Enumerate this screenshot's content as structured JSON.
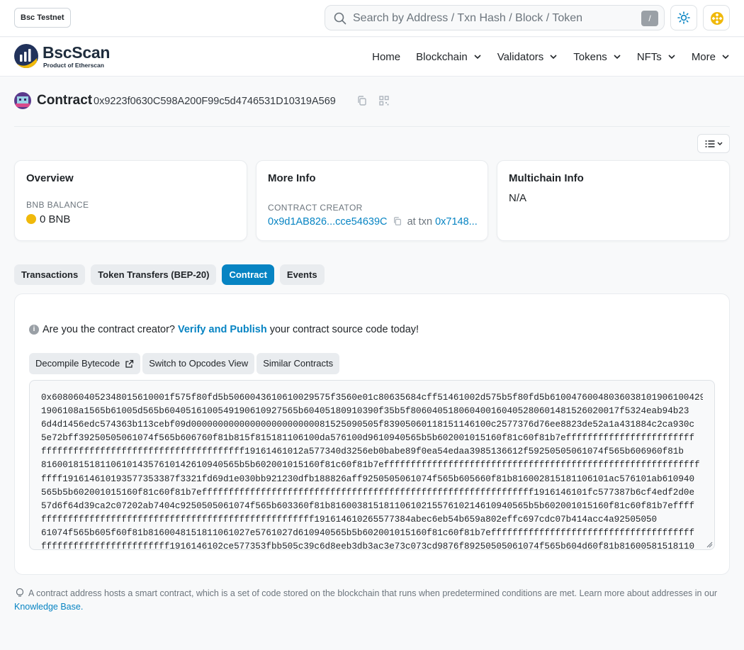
{
  "network_badge": "Bsc Testnet",
  "search": {
    "placeholder": "Search by Address / Txn Hash / Block / Token",
    "shortcut": "/"
  },
  "brand": {
    "name": "BscScan",
    "tagline": "Product of Etherscan"
  },
  "nav": {
    "items": [
      "Home",
      "Blockchain",
      "Validators",
      "Tokens",
      "NFTs",
      "More"
    ]
  },
  "contract": {
    "label": "Contract",
    "address": "0x9223f0630C598A200F99c5d4746531D10319A569"
  },
  "overview": {
    "title": "Overview",
    "balance_label": "BNB BALANCE",
    "balance_value": "0 BNB"
  },
  "more_info": {
    "title": "More Info",
    "creator_label": "CONTRACT CREATOR",
    "creator_address": "0x9d1AB826...cce54639C",
    "at_txn": "at txn",
    "txn_hash": "0x7148..."
  },
  "multichain": {
    "title": "Multichain Info",
    "value": "N/A"
  },
  "tabs": [
    {
      "label": "Transactions",
      "active": false
    },
    {
      "label": "Token Transfers (BEP-20)",
      "active": false
    },
    {
      "label": "Contract",
      "active": true
    },
    {
      "label": "Events",
      "active": false
    }
  ],
  "verify": {
    "prefix": "Are you the contract creator?",
    "link": "Verify and Publish",
    "suffix": "your contract source code today!"
  },
  "buttons": {
    "decompile": "Decompile Bytecode",
    "opcodes": "Switch to Opcodes View",
    "similar": "Similar Contracts"
  },
  "bytecode_lines": [
    "0x6080604052348015610001f575f80fd5b5060043610610029575f3560e01c80635684cff51461002d575b5f80fd5b61004760048036038101906100429",
    "1906108a1565b61005d565b6040516100549190610927565b60405180910390f35b5f80604051806040016040528060148152602001 7f5324eab94b23",
    "6d4d1456edc574363b113cebf09d00000000000000000000000081525090505f8390506011815114 6100c2577376d76ee8823de52a1a431884c2ca930c",
    "5e72bff39250505061074f565b606760f81b815f815181106100da576100d9610940565b5b6020010 15160f81c60f81b7effffffffffffffffffffffff",
    "ffffffffffffffffffffffffffffffffffffff19161461012a577340d3256eb0babe89f0ea54edaa398513 6612f59250505061074f565b606960f81b",
    "8160018151811061014357610142610940565b5b602001015160f81c60f81b7efffffffffffffffffffffffffffffffffffffffffffffffffffffffffff",
    "ffff191614610193577353387f3321fd69d1e030bb921230dfb188826aff9250505061074f565b605660f81b8160028151811061 01ac576101ab610940",
    "565b5b602001015160f81c60f81b7effffffffffffffffffffffffffffffffffffffffffffffffffffffffffffff1916146101fc577387b6cf4edf2d0e",
    "57d6f64d39ca2c07202ab7404c9250505061074f565b603360f81b8160038151811061021557610214610940565b5b602001015160f81c60f81b7effff",
    "fffffffffffffffffffffffffffffffffffffffffffffffffff19161461026557 7384abec6eb54b659a802effc697cdc07b414acc4a92505050",
    "61074f565b605f60f81b8160048151811061027e5761027d610940565b5b602001015160f81c60f81b7effffffffffffffffffffffffffffffffffffff",
    "ffffffffffffffffffffffff1916146102ce577353fbb505c39c6d8eeb3db3ac3e73c073cd9876f89250505061074f565b604d60f81b81600581518110"
  ],
  "footnote": {
    "text": "A contract address hosts a smart contract, which is a set of code stored on the blockchain that runs when predetermined conditions are met. Learn more about addresses in our",
    "link": "Knowledge Base."
  },
  "colors": {
    "accent": "#0784c3",
    "bnb": "#f0b90b",
    "brand_dark": "#21325b"
  }
}
